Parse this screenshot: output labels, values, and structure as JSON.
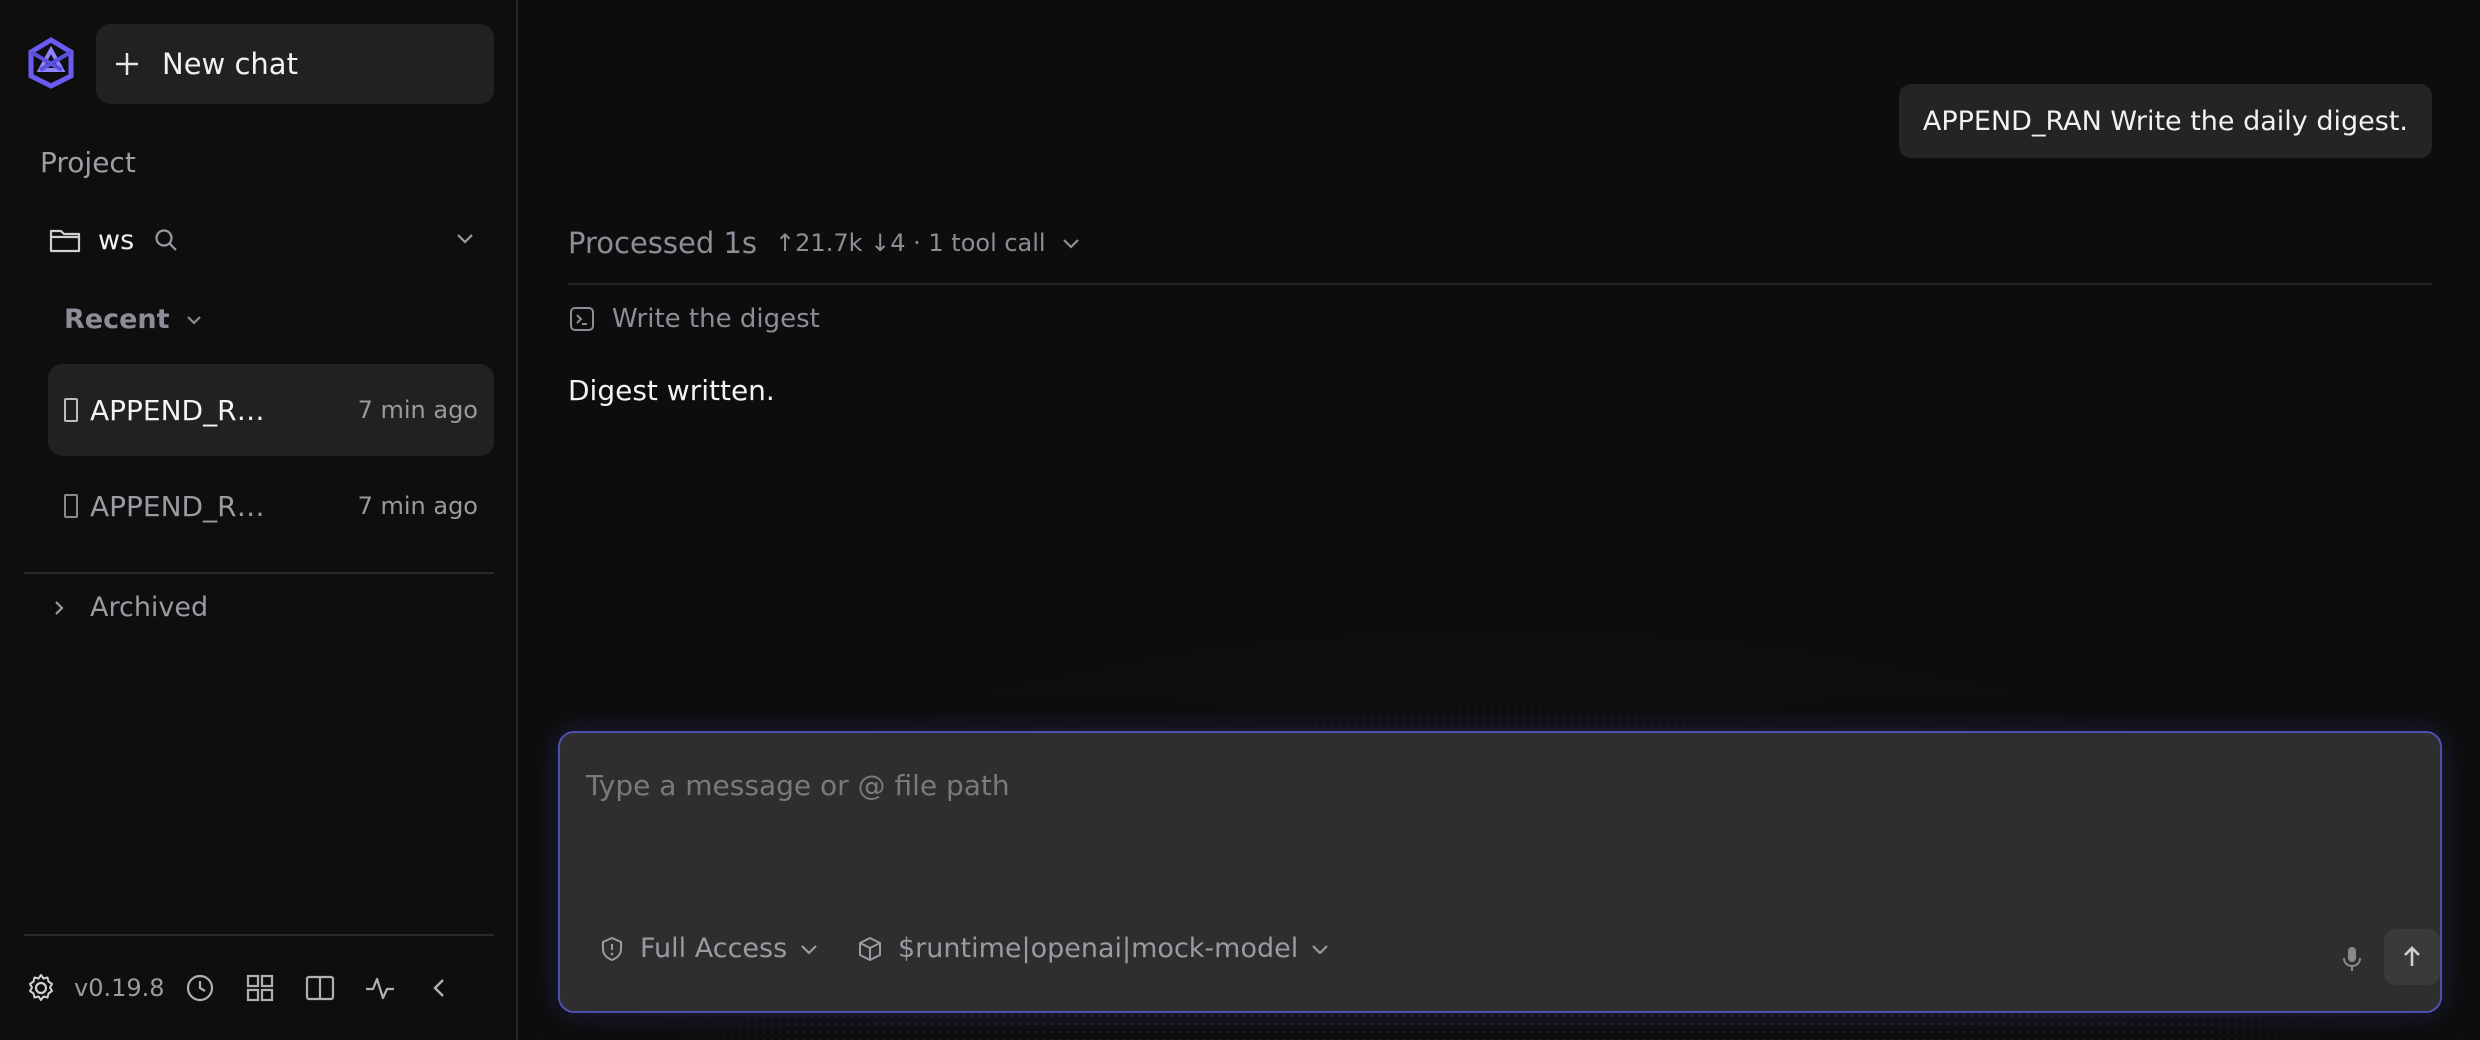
{
  "sidebar": {
    "new_chat_label": "New chat",
    "project_label": "Project",
    "workspace_name": "ws",
    "recent_label": "Recent",
    "chats": [
      {
        "title": "APPEND_R…",
        "time": "7 min ago"
      },
      {
        "title": "APPEND_R…",
        "time": "7 min ago"
      }
    ],
    "archived_label": "Archived",
    "version": "v0.19.8"
  },
  "conversation": {
    "user_message": "APPEND_RAN Write the daily digest.",
    "processed_label": "Processed 1s",
    "processed_stats": "↑21.7k ↓4 · 1 tool call",
    "tool_call_label": "Write the digest",
    "assistant_reply": "Digest written."
  },
  "composer": {
    "placeholder": "Type a message or @ file path",
    "value": "",
    "access_label": "Full Access",
    "model_label": "$runtime|openai|mock-model"
  },
  "colors": {
    "accent": "#5a4fd8",
    "composer_border": "#4f4fae",
    "background": "#0d0d0d"
  }
}
